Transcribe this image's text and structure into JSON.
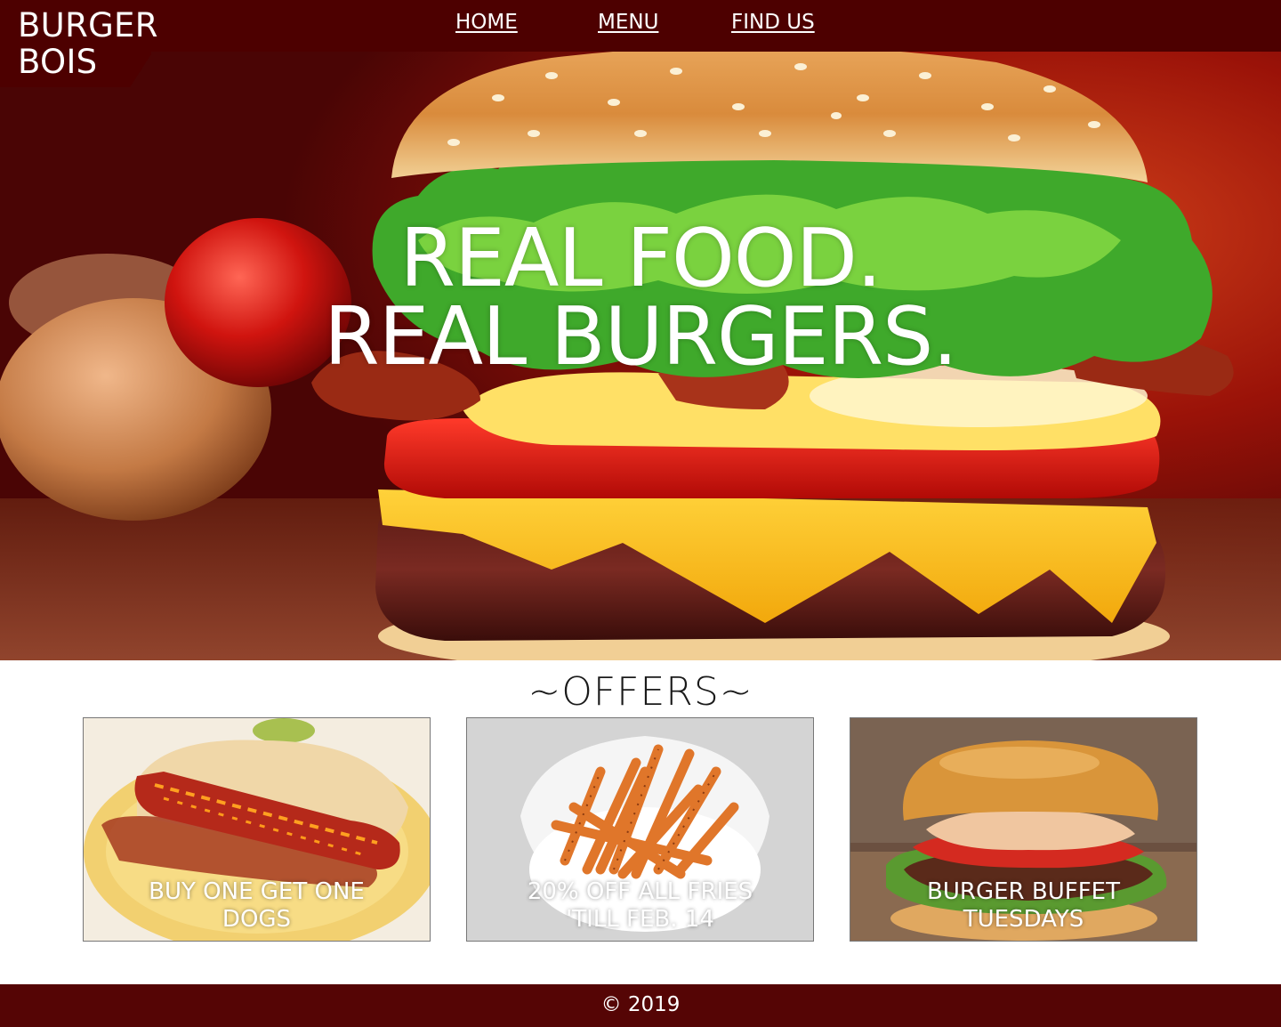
{
  "brand": {
    "line1": "BURGER",
    "line2": "BOIS"
  },
  "nav": [
    {
      "label": "HOME"
    },
    {
      "label": "MENU"
    },
    {
      "label": "FIND US"
    }
  ],
  "hero": {
    "line1": "REAL FOOD.",
    "line2": "REAL BURGERS."
  },
  "offers": {
    "title": "~OFFERS~",
    "items": [
      {
        "caption_line1": "BUY ONE GET ONE",
        "caption_line2": "DOGS",
        "image": "hotdog-photo"
      },
      {
        "caption_line1": "20% OFF ALL FRIES",
        "caption_line2": "'TILL FEB. 14",
        "image": "fries-photo"
      },
      {
        "caption_line1": "BURGER BUFFET",
        "caption_line2": "TUESDAYS",
        "image": "burger-photo"
      }
    ]
  },
  "footer": {
    "copyright": "© 2019"
  },
  "colors": {
    "header_bg": "#4d0000",
    "footer_bg": "#550505",
    "text_light": "#ffffff"
  }
}
